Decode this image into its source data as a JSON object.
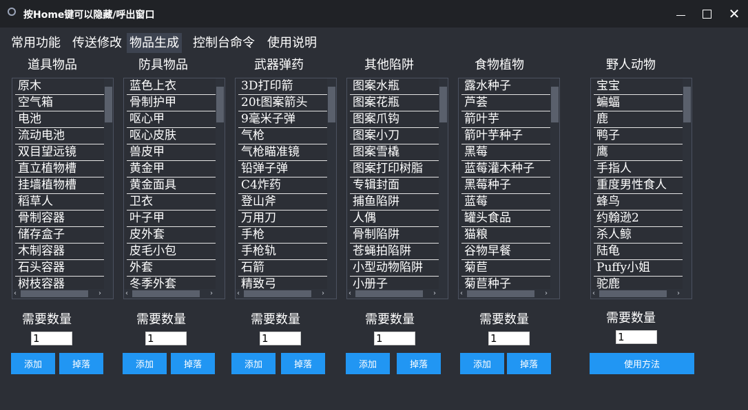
{
  "window": {
    "title": "按Home键可以隐藏/呼出窗口",
    "minimize_icon": "minimize-icon",
    "maximize_icon": "maximize-icon",
    "close_glyph": "✕"
  },
  "tabs": [
    {
      "label": "常用功能"
    },
    {
      "label": "传送修改"
    },
    {
      "label": "物品生成",
      "active": true
    },
    {
      "label": "控制台命令"
    },
    {
      "label": "使用说明"
    }
  ],
  "columns": [
    {
      "key": "tools",
      "header": "道具物品",
      "items": [
        "原木",
        "空气箱",
        "电池",
        "流动电池",
        "双目望远镜",
        "直立植物槽",
        "挂墙植物槽",
        "稻草人",
        "骨制容器",
        "储存盒子",
        "木制容器",
        "石头容器",
        "树枝容器"
      ],
      "qty_label": "需要数量",
      "qty_value": "1",
      "add_label": "添加",
      "drop_label": "掉落"
    },
    {
      "key": "armor",
      "header": "防具物品",
      "items": [
        "蓝色上衣",
        "骨制护甲",
        "呕心甲",
        "呕心皮肤",
        "兽皮甲",
        "黄金甲",
        "黄金面具",
        "卫衣",
        "叶子甲",
        "皮外套",
        "皮毛小包",
        "外套",
        "冬季外套"
      ],
      "qty_label": "需要数量",
      "qty_value": "1",
      "add_label": "添加",
      "drop_label": "掉落"
    },
    {
      "key": "weapons",
      "header": "武器弹药",
      "items": [
        "3D打印箭",
        "20t图案箭头",
        "9毫米子弹",
        "气枪",
        "气枪瞄准镜",
        "铅弹子弹",
        "C4炸药",
        "登山斧",
        "万用刀",
        "手枪",
        "手枪轨",
        "石箭",
        "精致弓"
      ],
      "qty_label": "需要数量",
      "qty_value": "1",
      "add_label": "添加",
      "drop_label": "掉落"
    },
    {
      "key": "traps",
      "header": "其他陷阱",
      "items": [
        "图案水瓶",
        "图案花瓶",
        "图案爪钩",
        "图案小刀",
        "图案雪橇",
        "图案打印树脂",
        "专辑封面",
        "捕鱼陷阱",
        "人偶",
        "骨制陷阱",
        "苍蝇拍陷阱",
        "小型动物陷阱",
        "小册子"
      ],
      "qty_label": "需要数量",
      "qty_value": "1",
      "add_label": "添加",
      "drop_label": "掉落"
    },
    {
      "key": "food",
      "header": "食物植物",
      "items": [
        "露水种子",
        "芦荟",
        "箭叶芋",
        "箭叶芋种子",
        "黑莓",
        "蓝莓灌木种子",
        "黑莓种子",
        "蓝莓",
        "罐头食品",
        "猫粮",
        "谷物早餐",
        "菊苣",
        "菊苣种子"
      ],
      "qty_label": "需要数量",
      "qty_value": "1",
      "add_label": "添加",
      "drop_label": "掉落"
    },
    {
      "key": "animals",
      "header": "野人动物",
      "items": [
        "宝宝",
        "蝙蝠",
        "鹿",
        "鸭子",
        "鹰",
        "手指人",
        "重度男性食人",
        "蜂鸟",
        "约翰逊2",
        "杀人鲸",
        "陆龟",
        "Puffy小姐",
        "驼鹿"
      ],
      "qty_label": "需要数量",
      "qty_value": "1",
      "usage_label": "使用方法"
    }
  ],
  "scroll": {
    "left_arrow": "‹",
    "right_arrow": "›"
  },
  "colors": {
    "background": "#2c2f36",
    "titlebar": "#202226",
    "accent_button": "#2196f3",
    "active_tab": "#3d4350"
  }
}
